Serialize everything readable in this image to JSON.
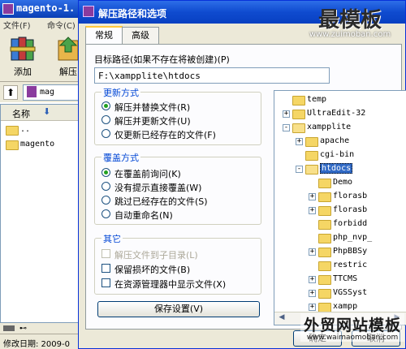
{
  "background_window": {
    "title": "magento-1.",
    "menu": [
      "文件(F)",
      "命令(C)"
    ],
    "toolbar": [
      {
        "label": "添加",
        "icon": "winrar-books-icon"
      },
      {
        "label": "解压",
        "icon": "extract-icon"
      }
    ],
    "address_fragment": "mag",
    "list_header": "名称",
    "list_items": [
      "..",
      "magento"
    ],
    "status": "修改日期: 2009-0"
  },
  "dialog": {
    "title": "解压路径和选项",
    "tabs": [
      "常规",
      "高级"
    ],
    "target_label": "目标路径(如果不存在将被创建)(P)",
    "target_value": "F:\\xampplite\\htdocs",
    "update_group": {
      "title": "更新方式",
      "options": [
        "解压并替换文件(R)",
        "解压并更新文件(U)",
        "仅更新已经存在的文件(F)"
      ],
      "selected": 0
    },
    "overwrite_group": {
      "title": "覆盖方式",
      "options": [
        "在覆盖前询问(K)",
        "没有提示直接覆盖(W)",
        "跳过已经存在的文件(S)",
        "自动重命名(N)"
      ],
      "selected": 0
    },
    "misc_group": {
      "title": "其它",
      "options": [
        "解压文件到子目录(L)",
        "保留损坏的文件(B)",
        "在资源管理器中显示文件(X)"
      ],
      "disabled": [
        true,
        false,
        false
      ]
    },
    "save_button": "保存设置(V)",
    "ok_button": "确定",
    "cancel_button": "取消"
  },
  "tree": [
    {
      "name": "temp",
      "level": 1,
      "expander": "",
      "open": false
    },
    {
      "name": "UltraEdit-32",
      "level": 1,
      "expander": "+",
      "open": false
    },
    {
      "name": "xampplite",
      "level": 1,
      "expander": "-",
      "open": true
    },
    {
      "name": "apache",
      "level": 2,
      "expander": "+",
      "open": false
    },
    {
      "name": "cgi-bin",
      "level": 2,
      "expander": "",
      "open": false
    },
    {
      "name": "htdocs",
      "level": 2,
      "expander": "-",
      "open": true,
      "selected": true
    },
    {
      "name": "Demo",
      "level": 3,
      "expander": "",
      "open": false
    },
    {
      "name": "florasb",
      "level": 3,
      "expander": "+",
      "open": false
    },
    {
      "name": "florasb",
      "level": 3,
      "expander": "+",
      "open": false
    },
    {
      "name": "forbidd",
      "level": 3,
      "expander": "",
      "open": false
    },
    {
      "name": "php_nvp_",
      "level": 3,
      "expander": "",
      "open": false
    },
    {
      "name": "PhpBBSy",
      "level": 3,
      "expander": "+",
      "open": false
    },
    {
      "name": "restric",
      "level": 3,
      "expander": "",
      "open": false
    },
    {
      "name": "TTCMS",
      "level": 3,
      "expander": "+",
      "open": false
    },
    {
      "name": "VGSSyst",
      "level": 3,
      "expander": "+",
      "open": false
    },
    {
      "name": "xampp",
      "level": 3,
      "expander": "+",
      "open": false
    }
  ],
  "watermark_top": {
    "text": "最模板",
    "url": "www.zuimoban.com"
  },
  "watermark_bottom": {
    "text": "外贸网站模板",
    "url": "www.waimaomoban.com"
  },
  "colors": {
    "title_blue": "#0a3fb5",
    "group_title": "#0046d5",
    "selection": "#316ac5"
  }
}
